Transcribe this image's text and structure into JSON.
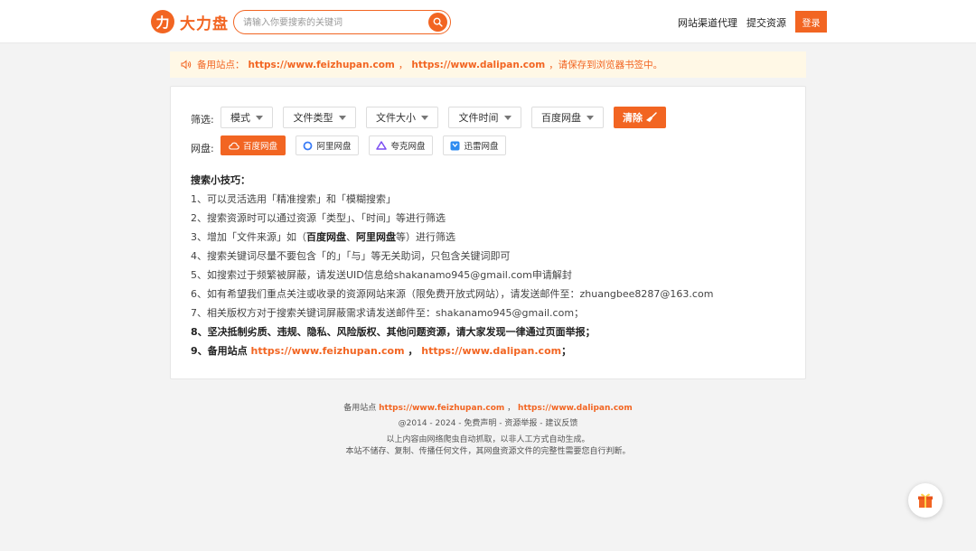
{
  "header": {
    "logo_mark": "力",
    "logo_text": "大力盘",
    "search_placeholder": "请输入你要搜索的关键词",
    "nav_channel": "网站渠道代理",
    "nav_submit": "提交资源",
    "login_label": "登录"
  },
  "notice": {
    "prefix": "备用站点：",
    "link1": "https://www.feizhupan.com",
    "sep": "，",
    "link2": "https://www.dalipan.com",
    "suffix": "，请保存到浏览器书签中。"
  },
  "filters": {
    "label": "筛选:",
    "items": [
      "模式",
      "文件类型",
      "文件大小",
      "文件时间",
      "百度网盘"
    ],
    "clear_label": "清除"
  },
  "disks": {
    "label": "网盘:",
    "items": [
      "百度网盘",
      "阿里网盘",
      "夸克网盘",
      "迅雷网盘"
    ]
  },
  "tips": {
    "title": "搜索小技巧：",
    "t1": "1、可以灵活选用「精准搜索」和「模糊搜索」",
    "t2": "2、搜索资源时可以通过资源「类型」、「时间」等进行筛选",
    "t3_pre": "3、增加「文件来源」如（",
    "t3_b1": "百度网盘",
    "t3_mid": "、",
    "t3_b2": "阿里网盘",
    "t3_post": "等）进行筛选",
    "t4": "4、搜索关键词尽量不要包含「的」「与」等无关助词，只包含关键词即可",
    "t5": "5、如搜索过于频繁被屏蔽，请发送UID信息给shakanamo945@gmail.com申请解封",
    "t6": "6、如有希望我们重点关注或收录的资源网站来源（限免费开放式网站），请发送邮件至：zhuangbee8287@163.com",
    "t7": "7、相关版权方对于搜索关键词屏蔽需求请发送邮件至：shakanamo945@gmail.com；",
    "t8": "8、坚决抵制劣质、违规、隐私、风险版权、其他问题资源，请大家发现一律通过页面举报；",
    "t9_pre": "9、备用站点 ",
    "t9_link1": "https://www.feizhupan.com",
    "t9_sep": " ， ",
    "t9_link2": "https://www.dalipan.com",
    "t9_post": "；"
  },
  "footer": {
    "backup_pre": "备用站点 ",
    "backup_link1": "https://www.feizhupan.com",
    "backup_sep": " ， ",
    "backup_link2": "https://www.dalipan.com",
    "copyright": "@2014 - 2024 - 免费声明 - 资源举报 - 建议反馈",
    "disclaimer1": "以上内容由网络爬虫自动抓取，以非人工方式自动生成。",
    "disclaimer2": "本站不储存、复制、传播任何文件，其网盘资源文件的完整性需要您自行判断。"
  },
  "colors": {
    "accent": "#f26522",
    "notice_bg": "#fff8e6"
  }
}
